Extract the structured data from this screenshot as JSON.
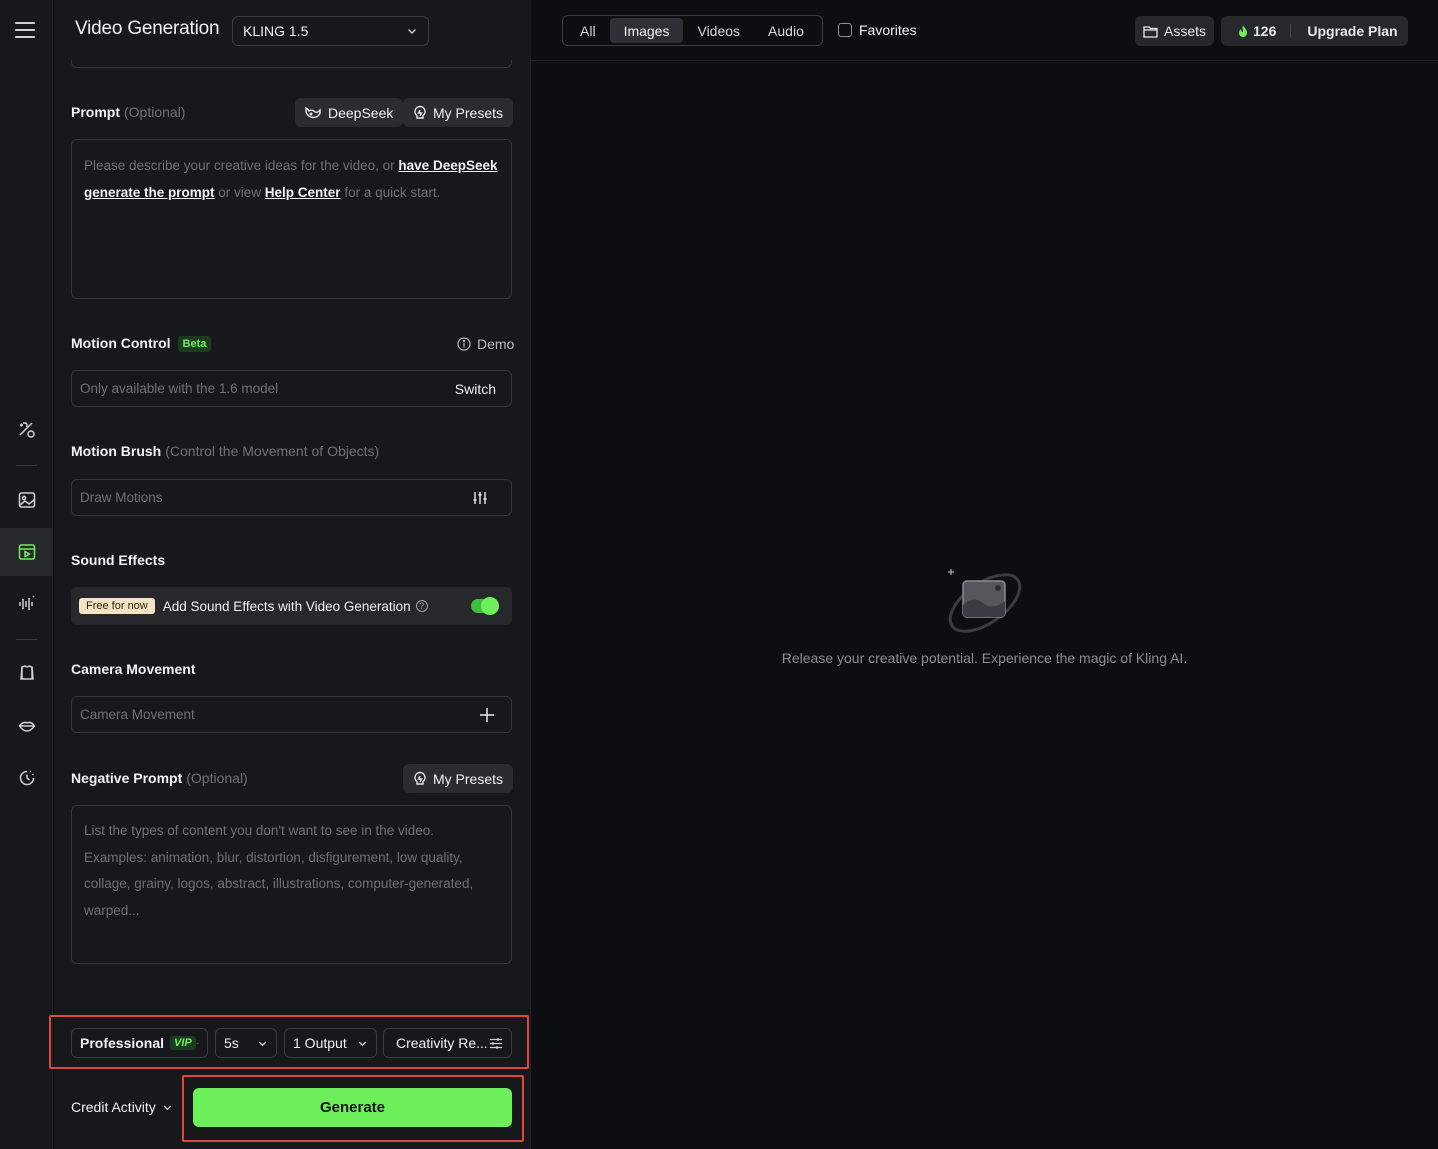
{
  "header": {
    "app_title": "Video Generation",
    "model": "KLING 1.5"
  },
  "prompt": {
    "label": "Prompt",
    "optional": "(Optional)",
    "deepseek_label": "DeepSeek",
    "presets_label": "My Presets",
    "placeholder_a": "Please describe your creative ideas for the video, or ",
    "link_deepseek_1": "have DeepSeek",
    "link_deepseek_2": "generate the prompt",
    "placeholder_b": " or view ",
    "link_help": "Help Center",
    "placeholder_c": " for a quick start."
  },
  "motion_control": {
    "label": "Motion Control",
    "badge": "Beta",
    "demo": "Demo",
    "placeholder": "Only available with the 1.6 model",
    "switch": "Switch"
  },
  "motion_brush": {
    "label": "Motion Brush",
    "note": "(Control the Movement of Objects)",
    "placeholder": "Draw Motions"
  },
  "sound_effects": {
    "label": "Sound Effects",
    "badge": "Free for now",
    "text": "Add Sound Effects with Video Generation",
    "enabled": true
  },
  "camera_movement": {
    "label": "Camera Movement",
    "placeholder": "Camera Movement"
  },
  "negative_prompt": {
    "label": "Negative Prompt",
    "optional": "(Optional)",
    "presets_label": "My Presets",
    "placeholder": "List the types of content you don't want to see in the video. Examples: animation, blur, distortion, disfigurement, low quality, collage, grainy, logos, abstract, illustrations, computer-generated, warped..."
  },
  "controls": {
    "mode": "Professional",
    "mode_badge": "VIP",
    "duration": "5s",
    "outputs": "1 Output",
    "creativity": "Creativity Re..."
  },
  "footer": {
    "credit_activity": "Credit Activity",
    "generate": "Generate"
  },
  "topbar": {
    "filters": [
      "All",
      "Images",
      "Videos",
      "Audio"
    ],
    "active_filter": "Images",
    "favorites": "Favorites",
    "assets": "Assets",
    "credits": "126",
    "upgrade": "Upgrade Plan"
  },
  "empty_state": {
    "message": "Release your creative potential. Experience the magic of Kling AI."
  },
  "colors": {
    "accent": "#6ef05b",
    "highlight_border": "#e2463b",
    "background": "#0d0e10",
    "panel": "#17181b"
  },
  "icons": {
    "rail": [
      "menu-icon",
      "magic-icon",
      "image-icon",
      "video-icon",
      "audio-icon",
      "tshirt-icon",
      "lips-icon",
      "history-icon"
    ]
  }
}
